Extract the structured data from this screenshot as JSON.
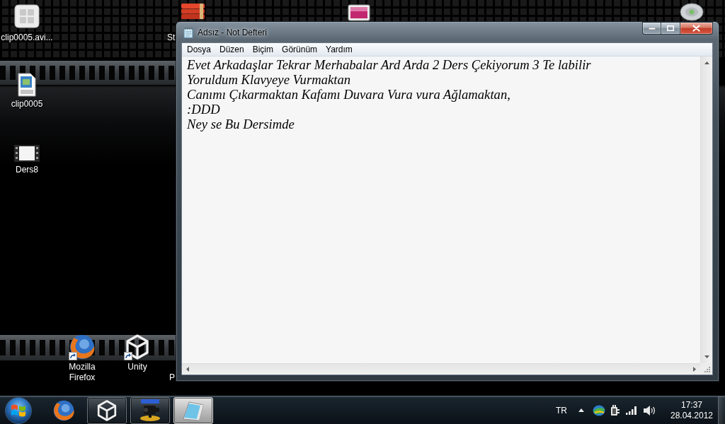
{
  "desktop": {
    "icons": [
      {
        "kind": "tile",
        "label": "clip0005.avi...",
        "shortcut": false
      },
      {
        "kind": "books",
        "label": "St"
      },
      {
        "kind": "picture"
      },
      {
        "kind": "disc"
      },
      {
        "kind": "video",
        "label": "clip0005",
        "shortcut": false
      },
      {
        "kind": "film",
        "label": "Ders8",
        "shortcut": false
      },
      {
        "kind": "browser",
        "label": "Mozilla Firefox",
        "shortcut": true
      },
      {
        "kind": "cube",
        "label": "Unity",
        "shortcut": true
      },
      {
        "kind": "covered",
        "label": "P"
      }
    ]
  },
  "notepad_window": {
    "title": "Adsız - Not Defteri",
    "menu": [
      "Dosya",
      "Düzen",
      "Biçim",
      "Görünüm",
      "Yardım"
    ],
    "lines": [
      "Evet Arkadaşlar Tekrar Merhabalar Ard Arda 2 Ders Çekiyorum 3 Te labilir",
      "Yoruldum Klavyeye Vurmaktan",
      "Canımı Çıkarmaktan Kafamı Duvara Vura vura Ağlamaktan,",
      ":DDD",
      "Ney se Bu Dersimde"
    ]
  },
  "taskbar": {
    "items": [
      {
        "kind": "browser",
        "running": false,
        "selected": false
      },
      {
        "kind": "cube",
        "running": true,
        "selected": false
      },
      {
        "kind": "camera",
        "running": true,
        "selected": false
      },
      {
        "kind": "notepad",
        "running": true,
        "selected": true
      }
    ],
    "language": "TR",
    "clock": {
      "time": "17:37",
      "date": "28.04.2012"
    }
  }
}
